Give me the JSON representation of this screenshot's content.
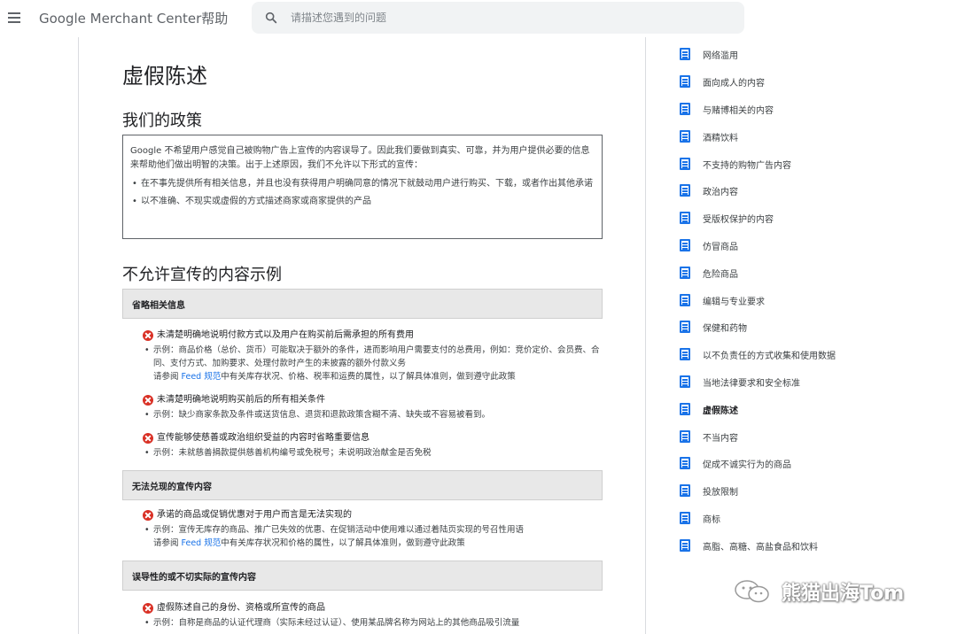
{
  "header": {
    "app_title": "Google Merchant Center帮助",
    "search_placeholder": "请描述您遇到的问题"
  },
  "article": {
    "title": "虚假陈述",
    "policy_heading": "我们的政策",
    "policy_intro": "Google 不希望用户感觉自己被购物广告上宣传的内容误导了。因此我们要做到真实、可靠，并为用户提供必要的信息来帮助他们做出明智的决策。出于上述原因，我们不允许以下形式的宣传：",
    "policy_items": [
      "在不事先提供所有相关信息，并且也没有获得用户明确同意的情况下就鼓动用户进行购买、下载，或者作出其他承诺",
      "以不准确、不现实或虚假的方式描述商家或商家提供的产品"
    ],
    "examples_heading": "不允许宣传的内容示例",
    "sections": [
      {
        "title": "省略相关信息",
        "rules": [
          {
            "head": "未清楚明确地说明付款方式以及用户在购买前后需承担的所有费用",
            "example": "示例：商品价格（总价、货币）可能取决于额外的条件，进而影响用户需要支付的总费用，例如：竞价定价、会员费、合同、支付方式、加购要求、处理付款时产生的未披露的额外付款义务",
            "see_pre": "请参阅 ",
            "see_link": "Feed 规范",
            "see_post": "中有关库存状况、价格、税率和运费的属性，以了解具体准则，做到遵守此政策"
          },
          {
            "head": "未清楚明确地说明购买前后的所有相关条件",
            "example": "示例：缺少商家条款及条件或送货信息、退货和退款政策含糊不清、缺失或不容易被看到。"
          },
          {
            "head": "宣传能够使慈善或政治组织受益的内容时省略重要信息",
            "example": "示例：未就慈善捐款提供慈善机构编号或免税号；未说明政治献金是否免税"
          }
        ]
      },
      {
        "title": "无法兑现的宣传内容",
        "rules": [
          {
            "head": "承诺的商品或促销优惠对于用户而言是无法实现的",
            "example": "示例：宣传无库存的商品、推广已失效的优惠、在促销活动中使用难以通过着陆页实现的号召性用语",
            "see_pre": "请参阅 ",
            "see_link": "Feed 规范",
            "see_post": "中有关库存状况和价格的属性，以了解具体准则，做到遵守此政策"
          }
        ]
      },
      {
        "title": "误导性的或不切实际的宣传内容",
        "rules": [
          {
            "head": "虚假陈述自己的身份、资格或所宣传的商品",
            "example": "示例：自称是商品的认证代理商（实际未经过认证）、使用某品牌名称为网站上的其他商品吸引流量"
          }
        ]
      }
    ]
  },
  "sidebar": {
    "items": [
      {
        "label": "网络滥用",
        "active": false
      },
      {
        "label": "面向成人的内容",
        "active": false
      },
      {
        "label": "与赌博相关的内容",
        "active": false
      },
      {
        "label": "酒精饮料",
        "active": false
      },
      {
        "label": "不支持的购物广告内容",
        "active": false
      },
      {
        "label": "政治内容",
        "active": false
      },
      {
        "label": "受版权保护的内容",
        "active": false
      },
      {
        "label": "仿冒商品",
        "active": false
      },
      {
        "label": "危险商品",
        "active": false
      },
      {
        "label": "编辑与专业要求",
        "active": false
      },
      {
        "label": "保健和药物",
        "active": false
      },
      {
        "label": "以不负责任的方式收集和使用数据",
        "active": false
      },
      {
        "label": "当地法律要求和安全标准",
        "active": false
      },
      {
        "label": "虚假陈述",
        "active": true
      },
      {
        "label": "不当内容",
        "active": false
      },
      {
        "label": "促成不诚实行为的商品",
        "active": false
      },
      {
        "label": "投放限制",
        "active": false
      },
      {
        "label": "商标",
        "active": false
      },
      {
        "label": "高脂、高糖、高盐食品和饮料",
        "active": false
      }
    ]
  },
  "watermark": {
    "text": "熊猫出海Tom",
    "icon": "wechat-icon"
  },
  "colors": {
    "accent": "#1a73e8",
    "error": "#d93025",
    "section_bg": "#e8e8e8"
  }
}
